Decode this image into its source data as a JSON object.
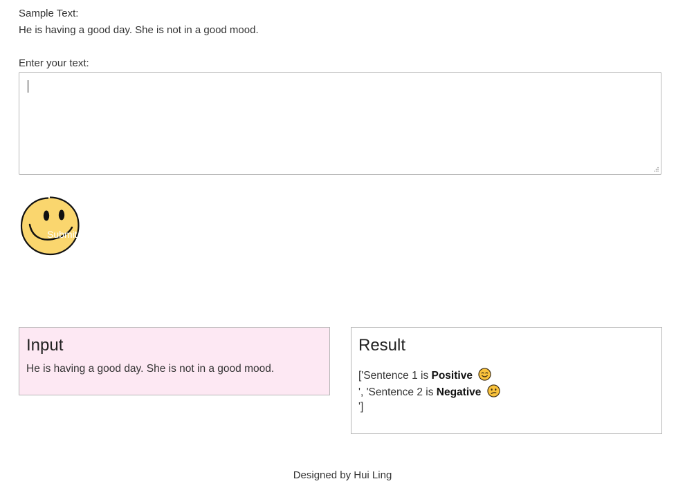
{
  "sample": {
    "label": "Sample Text:",
    "text": "He is having a good day. She is not in a good mood."
  },
  "form": {
    "label": "Enter your text:",
    "value": "",
    "submit_label": "Submit"
  },
  "input_panel": {
    "title": "Input",
    "content": "He is having a good day. She is not in a good mood."
  },
  "result_panel": {
    "title": "Result",
    "lines": [
      {
        "prefix": "['Sentence 1 is ",
        "sentiment": "Positive",
        "emoji": "smiling-face-icon"
      },
      {
        "prefix": "', 'Sentence 2 is ",
        "sentiment": "Negative",
        "emoji": "confused-face-icon"
      },
      {
        "prefix": "']",
        "sentiment": "",
        "emoji": ""
      }
    ]
  },
  "footer": {
    "text": "Designed by Hui Ling"
  },
  "colors": {
    "input_panel_bg": "#fde8f3",
    "smiley_yellow": "#fad66e",
    "emoji_yellow": "#f9c23c"
  }
}
